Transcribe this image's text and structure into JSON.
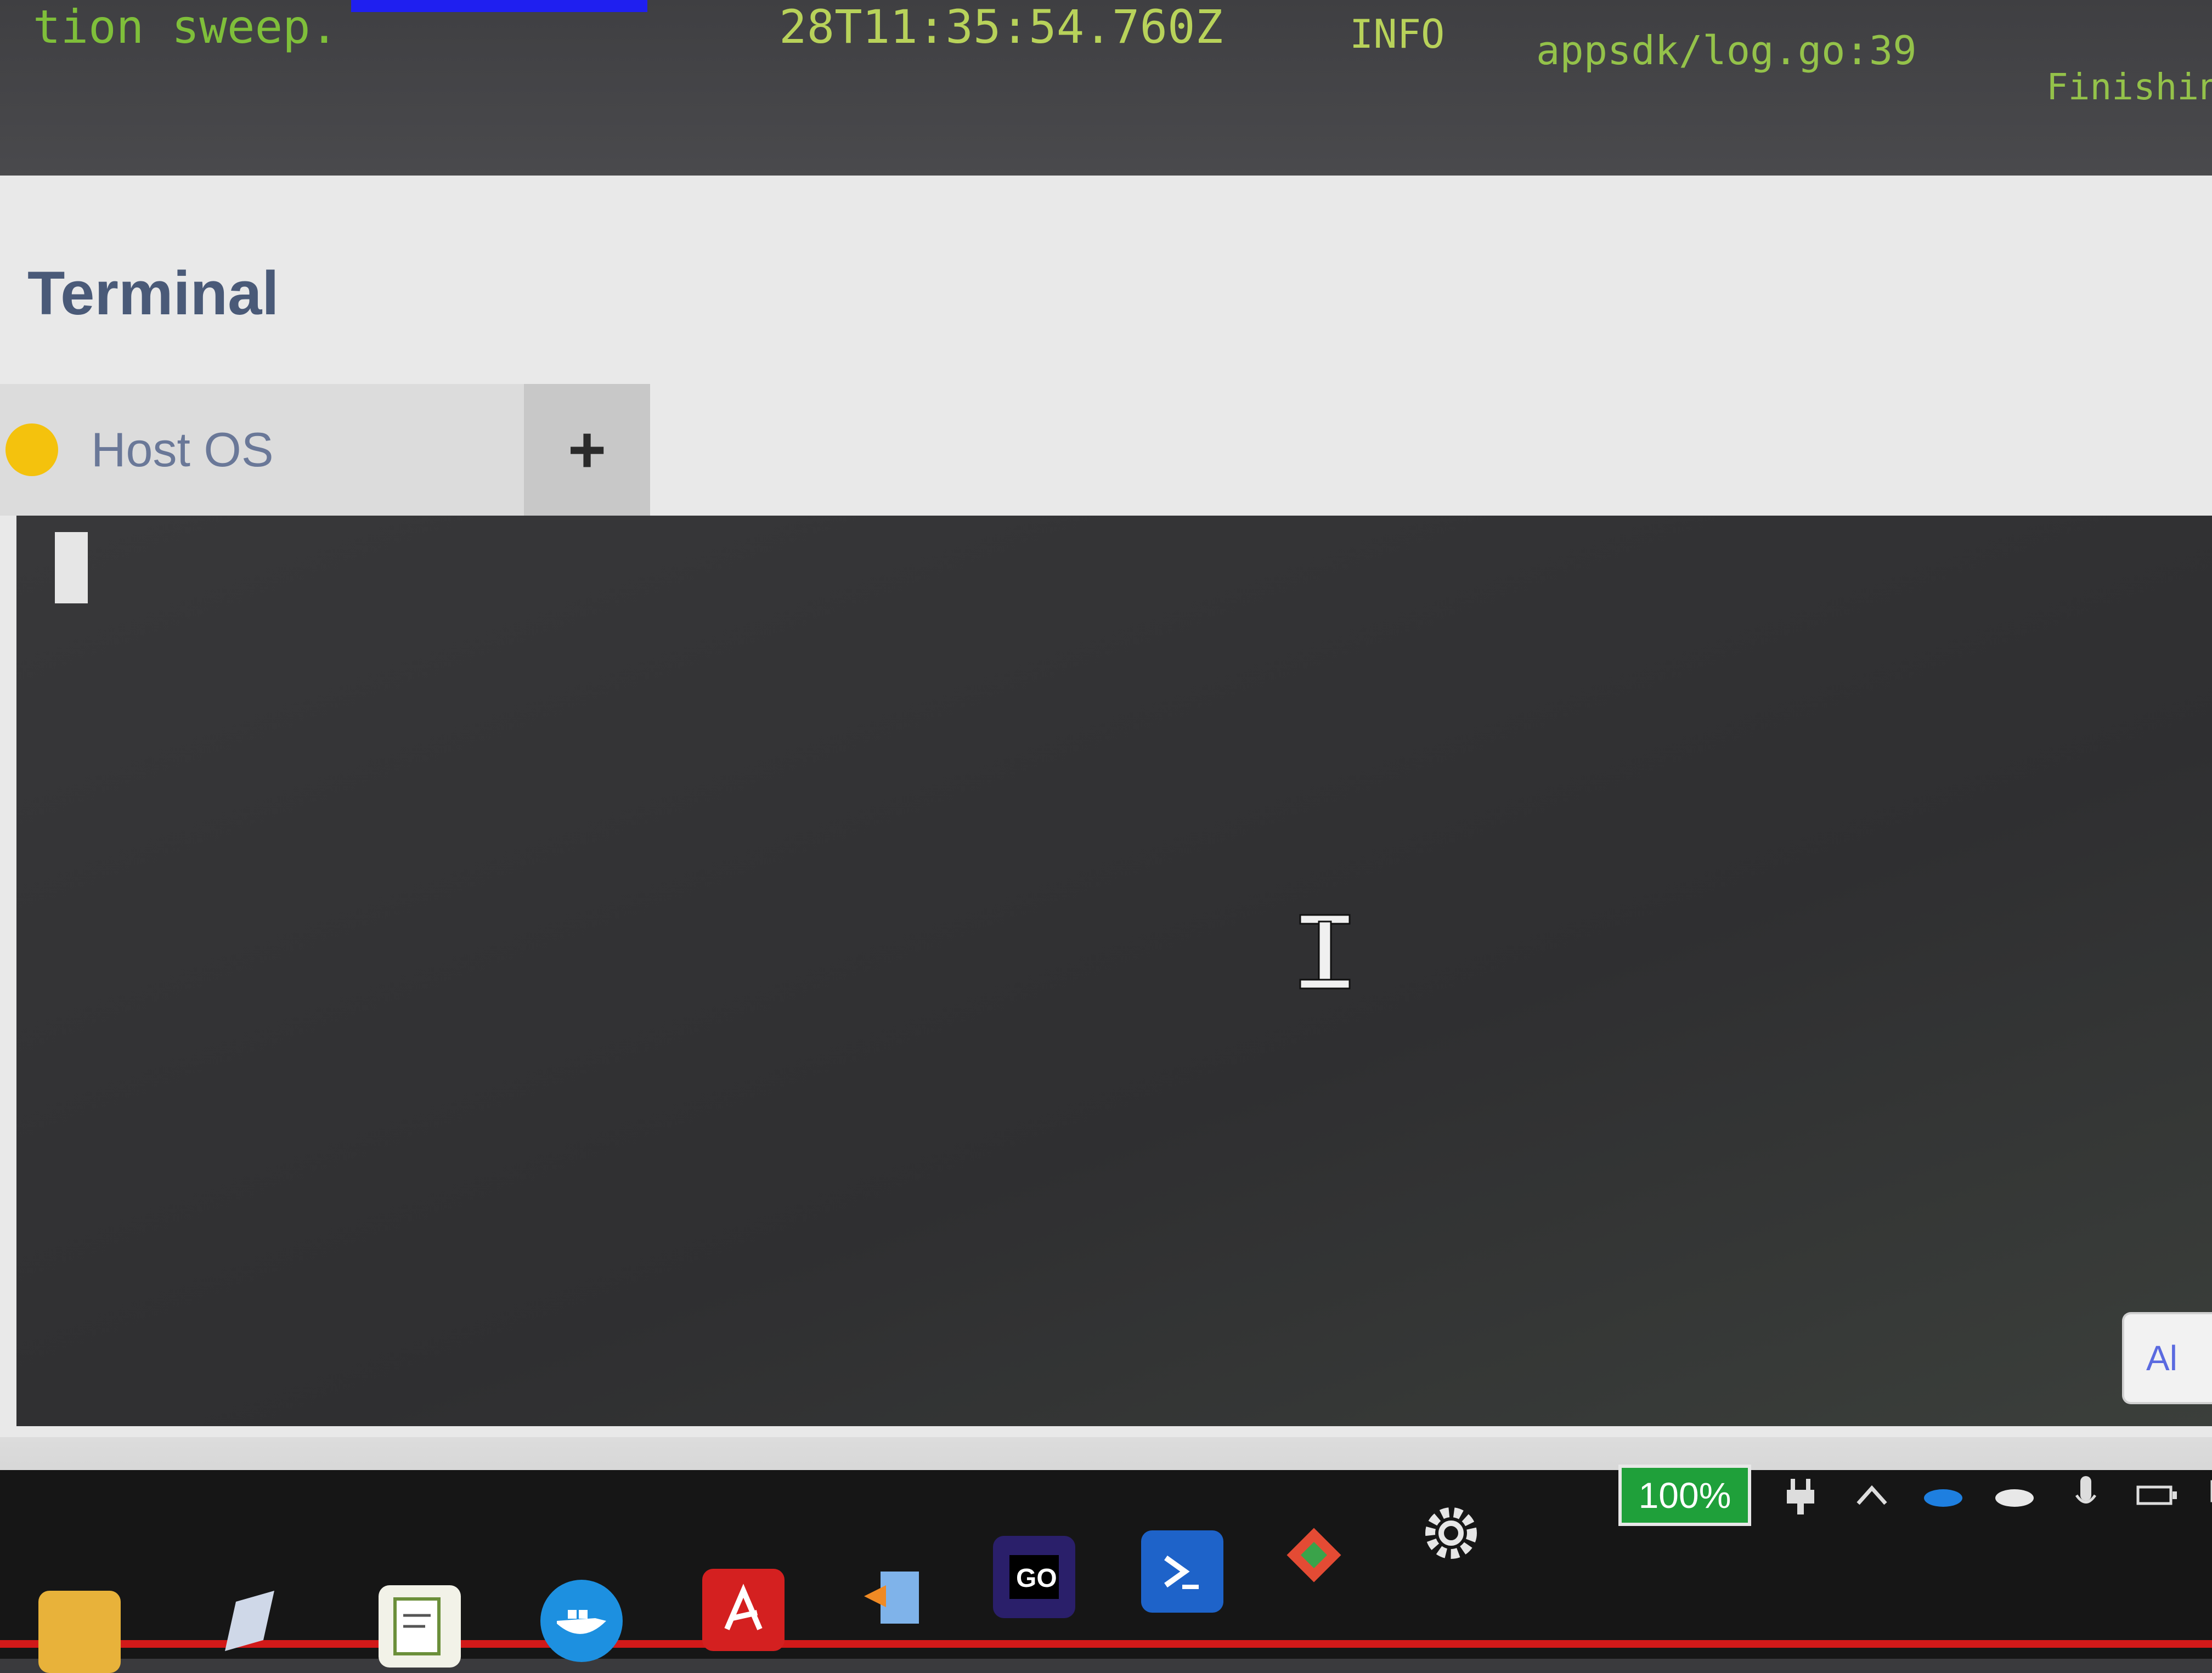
{
  "log": {
    "line_end": "tion sweep.",
    "timestamp_fragment": "28T11:35:54.760Z",
    "level": "INFO",
    "source": "appsdk/log.go:39",
    "message_start": "Finishing"
  },
  "window": {
    "title": "Terminal"
  },
  "tabs": [
    {
      "label": "Host OS",
      "status_color": "#f4c20d"
    }
  ],
  "tab_add_label": "+",
  "all_button_label": "Al",
  "taskbar": {
    "battery": "100%",
    "apps": [
      "folder-icon",
      "pen-icon",
      "notepad-icon",
      "docker-icon",
      "pdf-icon",
      "file-transfer-icon",
      "goland-icon",
      "powershell-icon",
      "git-icon",
      "settings-icon"
    ],
    "tray_icons": [
      "power-plug-icon",
      "chevron-up-icon",
      "onedrive-icon",
      "cloud-icon",
      "microphone-icon",
      "battery-icon",
      "network-icon",
      "speaker-icon"
    ]
  },
  "colors": {
    "log_text": "#7fbf3a",
    "accent": "#4a5a78",
    "battery": "#1fa03a"
  }
}
